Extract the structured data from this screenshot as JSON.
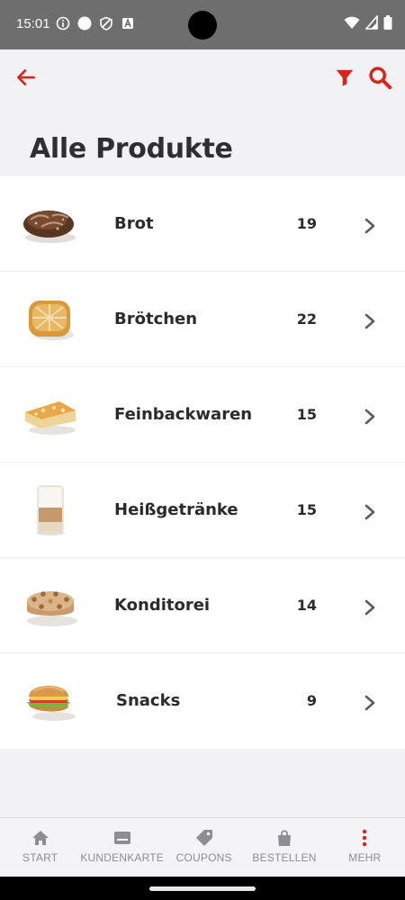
{
  "status_bar": {
    "time": "15:01",
    "icons": [
      "info-icon",
      "dot-icon",
      "shield-icon",
      "a-icon",
      "wifi-icon",
      "signal-icon",
      "battery-icon"
    ]
  },
  "header": {
    "back_icon": "arrow-left-icon",
    "filter_icon": "filter-icon",
    "search_icon": "search-icon",
    "accent_color": "#d9241b"
  },
  "page": {
    "title": "Alle Produkte"
  },
  "categories": [
    {
      "label": "Brot",
      "count": "19",
      "image": "bread-loaf"
    },
    {
      "label": "Brötchen",
      "count": "22",
      "image": "bread-roll"
    },
    {
      "label": "Feinbackwaren",
      "count": "15",
      "image": "pastry-slice"
    },
    {
      "label": "Heißgetränke",
      "count": "15",
      "image": "latte-glass"
    },
    {
      "label": "Konditorei",
      "count": "14",
      "image": "cake"
    },
    {
      "label": "Snacks",
      "count": "9",
      "image": "sandwich"
    }
  ],
  "bottom_nav": {
    "items": [
      {
        "label": "START",
        "icon": "home-icon"
      },
      {
        "label": "KUNDENKARTE",
        "icon": "card-icon"
      },
      {
        "label": "COUPONS",
        "icon": "tag-icon"
      },
      {
        "label": "BESTELLEN",
        "icon": "bag-icon"
      },
      {
        "label": "MEHR",
        "icon": "more-vertical-icon"
      }
    ],
    "active_color": "#d9241b",
    "inactive_color": "#8d8d93"
  }
}
